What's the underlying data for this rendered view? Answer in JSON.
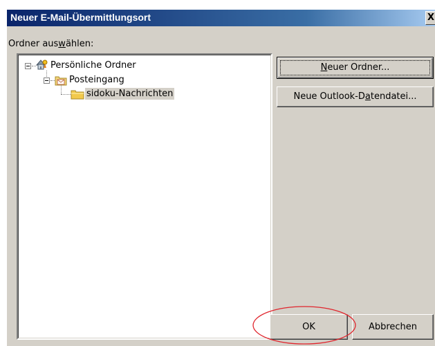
{
  "window": {
    "title": "Neuer E-Mail-Übermittlungsort",
    "close_label": "X"
  },
  "folder_picker": {
    "label_pre": "Ordner aus",
    "label_accel": "w",
    "label_post": "ählen:"
  },
  "tree": {
    "nodes": [
      {
        "label": "Persönliche Ordner",
        "icon": "personal-folders-icon",
        "expanded": true,
        "selected": false
      },
      {
        "label": "Posteingang",
        "icon": "inbox-folder-icon",
        "expanded": true,
        "selected": false
      },
      {
        "label": "sidoku-Nachrichten",
        "icon": "folder-icon",
        "expanded": false,
        "selected": true
      }
    ]
  },
  "buttons": {
    "new_folder": {
      "accel": "N",
      "rest": "euer Ordner..."
    },
    "new_datafile": {
      "pre": "Neue Outlook-D",
      "accel": "a",
      "post": "tendatei..."
    },
    "ok": "OK",
    "cancel": "Abbrechen"
  },
  "colors": {
    "titlebar_start": "#0a246a",
    "titlebar_end": "#a6caf0",
    "face": "#d4d0c8",
    "annotation": "#e0242c"
  }
}
